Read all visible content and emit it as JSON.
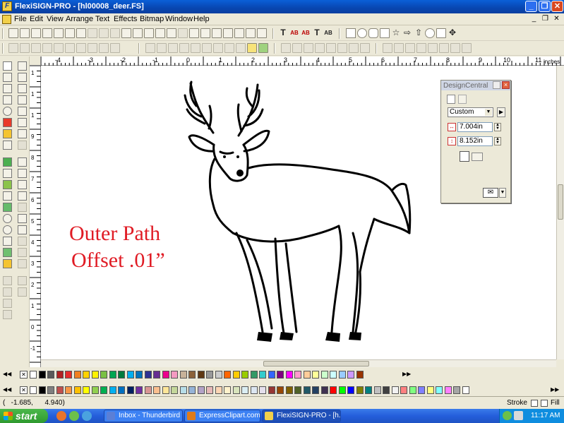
{
  "window": {
    "title": "FlexiSIGN-PRO - [hl00008_deer.FS]",
    "app_icon": "F",
    "controls": [
      "_",
      "❐",
      "✕"
    ]
  },
  "menubar": {
    "items": [
      "File",
      "Edit",
      "View",
      "Arrange",
      "Text",
      "Effects",
      "Bitmap",
      "Window",
      "Help"
    ],
    "mdi_controls": [
      "_",
      "❐",
      "✕"
    ]
  },
  "toolbar1": {
    "text_tools": [
      "T",
      "AB",
      "AB",
      "T",
      "AB"
    ]
  },
  "ruler": {
    "top_labels": [
      "-4",
      "-3",
      "-2",
      "-1",
      "0",
      "1",
      "2",
      "3",
      "4",
      "5",
      "6",
      "7",
      "8",
      "9",
      "10",
      "11"
    ],
    "unit": "inches",
    "left_labels": [
      "1",
      "1",
      "1",
      "9",
      "8",
      "7",
      "6",
      "5",
      "4",
      "3",
      "2",
      "1",
      "0",
      "-1"
    ]
  },
  "canvas": {
    "caption_line1": "Outer Path",
    "caption_line2": "Offset .01”",
    "caption_color": "#e01b24",
    "artwork_icon": "deer-line-art"
  },
  "design_central": {
    "title": "DesignCentral",
    "preset": "Custom",
    "width": "7.004in",
    "height": "8.152in"
  },
  "palette": {
    "colors_row1": [
      "#ffffff",
      "#000000",
      "#5a5a5a",
      "#b22222",
      "#e52b2b",
      "#f08020",
      "#ffd200",
      "#fff200",
      "#7ac143",
      "#00a651",
      "#007a3d",
      "#00aeef",
      "#0072bc",
      "#2e3192",
      "#662d91",
      "#ec008c",
      "#f49ac1",
      "#c7b299",
      "#8c6239",
      "#603813",
      "#999999",
      "#cccccc",
      "#ff6600",
      "#ffcc00",
      "#99cc00",
      "#339966",
      "#33cccc",
      "#3366ff",
      "#800080",
      "#ff00ff",
      "#ff99cc",
      "#ffcc99",
      "#ffff99",
      "#ccffcc",
      "#ccffff",
      "#99ccff",
      "#cc99ff",
      "#993300"
    ],
    "colors_row2": [
      "#ffffff",
      "#000000",
      "#7f7f7f",
      "#c0504d",
      "#f79646",
      "#ffc000",
      "#ffff00",
      "#92d050",
      "#00b050",
      "#00b0f0",
      "#0070c0",
      "#002060",
      "#7030a0",
      "#d99694",
      "#fabf8f",
      "#ffe699",
      "#c4d79b",
      "#b7dee8",
      "#95b3d7",
      "#b3a2c7",
      "#e6b8b7",
      "#fcd5b4",
      "#fff2cc",
      "#d8e4bc",
      "#dbeef3",
      "#dce6f1",
      "#e4dfec",
      "#963634",
      "#974706",
      "#7f6000",
      "#4f6228",
      "#215967",
      "#244062",
      "#3f3151",
      "#ff0000",
      "#00ff00",
      "#0000ff",
      "#808000",
      "#008080",
      "#c0c0c0",
      "#404040",
      "#f2f2f2",
      "#ff8080",
      "#80ff80",
      "#8080ff",
      "#ffff80",
      "#80ffff",
      "#ff80ff",
      "#a6a6a6",
      "#ffffff"
    ]
  },
  "status": {
    "coords": "(   -1.685,      4.940)",
    "stroke_label": "Stroke",
    "fill_label": "Fill"
  },
  "taskbar": {
    "start_label": "start",
    "tasks": [
      {
        "label": "Inbox - Thunderbird",
        "icon_color": "#5b7fd6"
      },
      {
        "label": "ExpressClipart.com...",
        "icon_color": "#e07b1a"
      },
      {
        "label": "FlexiSIGN-PRO - [h...",
        "icon_color": "#f2d04a"
      }
    ],
    "clock": "11:17 AM"
  }
}
